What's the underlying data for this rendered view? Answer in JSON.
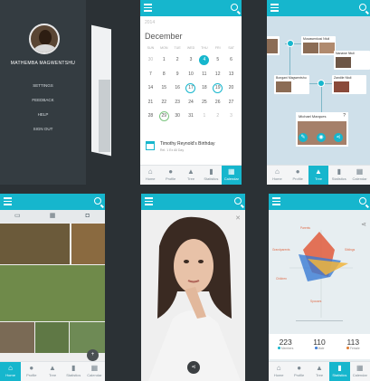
{
  "drawer": {
    "user_name": "MATHEMBA MAGWENTSHU",
    "menu": [
      "SETTINGS",
      "FEEDBACK",
      "HELP",
      "SIGN OUT"
    ]
  },
  "calendar": {
    "year": "2014",
    "month": "December",
    "weekdays": [
      "SUN",
      "MON",
      "TUE",
      "WED",
      "THU",
      "FRI",
      "SAT"
    ],
    "days": [
      {
        "d": "30",
        "s": "dim"
      },
      {
        "d": "1",
        "s": ""
      },
      {
        "d": "2",
        "s": ""
      },
      {
        "d": "3",
        "s": ""
      },
      {
        "d": "4",
        "s": "sel"
      },
      {
        "d": "5",
        "s": ""
      },
      {
        "d": "6",
        "s": ""
      },
      {
        "d": "7",
        "s": ""
      },
      {
        "d": "8",
        "s": ""
      },
      {
        "d": "9",
        "s": ""
      },
      {
        "d": "10",
        "s": ""
      },
      {
        "d": "11",
        "s": ""
      },
      {
        "d": "12",
        "s": ""
      },
      {
        "d": "13",
        "s": ""
      },
      {
        "d": "14",
        "s": ""
      },
      {
        "d": "15",
        "s": ""
      },
      {
        "d": "16",
        "s": ""
      },
      {
        "d": "17",
        "s": "ring"
      },
      {
        "d": "18",
        "s": ""
      },
      {
        "d": "19",
        "s": "ring"
      },
      {
        "d": "20",
        "s": ""
      },
      {
        "d": "21",
        "s": ""
      },
      {
        "d": "22",
        "s": ""
      },
      {
        "d": "23",
        "s": ""
      },
      {
        "d": "24",
        "s": ""
      },
      {
        "d": "25",
        "s": ""
      },
      {
        "d": "26",
        "s": ""
      },
      {
        "d": "27",
        "s": ""
      },
      {
        "d": "28",
        "s": ""
      },
      {
        "d": "29",
        "s": "ring2"
      },
      {
        "d": "30",
        "s": ""
      },
      {
        "d": "31",
        "s": ""
      },
      {
        "d": "1",
        "s": "dim"
      },
      {
        "d": "2",
        "s": "dim"
      },
      {
        "d": "3",
        "s": "dim"
      }
    ],
    "event_title": "Timothy Reynold's Birthday",
    "event_sub": "Rel. 1 Ex All Day"
  },
  "tabs": [
    "Home",
    "Profile",
    "Tree",
    "Statistics",
    "Calendar"
  ],
  "tree": {
    "top_card": "Musawenkosi Ntuli",
    "mid_right": "Nanawe Ntuli",
    "mid_left": "Bongani Magwentshu",
    "right_card": "Zandile Ntuli",
    "selected": "Michael Marques",
    "help": "?"
  },
  "stats": {
    "items": [
      {
        "n": "223",
        "l": "Members",
        "c": "#16b6cd"
      },
      {
        "n": "110",
        "l": "Male",
        "c": "#3a7bd5"
      },
      {
        "n": "113",
        "l": "Female",
        "c": "#e07a2f"
      }
    ],
    "axis_labels": [
      "Parents",
      "Grandparents",
      "Siblings",
      "Children",
      "Spouses"
    ]
  },
  "colors": {
    "accent": "#16b6cd",
    "dark": "#2b3135"
  }
}
